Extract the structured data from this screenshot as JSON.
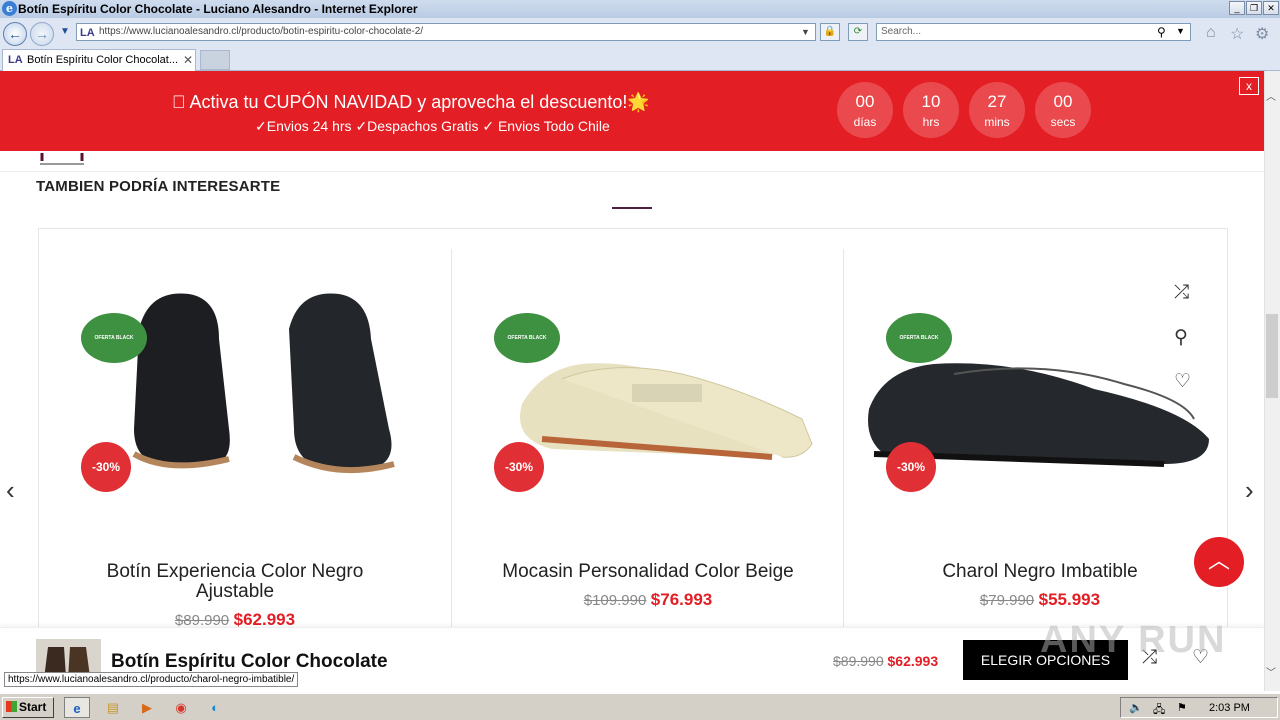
{
  "window": {
    "title": "Botín Espíritu Color Chocolate - Luciano Alesandro - Internet Explorer"
  },
  "address": {
    "favicon": "LA",
    "url": "https://www.lucianoalesandro.cl/producto/botin-espiritu-color-chocolate-2/"
  },
  "search": {
    "placeholder": "Search..."
  },
  "tab": {
    "label": "Botín Espíritu Color Chocolat..."
  },
  "promo": {
    "line1": "\u0000 Activa tu CUPÓN NAVIDAD y aprovecha el descuento!🌟",
    "line2": "✓Envios 24 hrs ✓Despachos Gratis ✓ Envios Todo Chile",
    "countdown": [
      {
        "value": "00",
        "unit": "días"
      },
      {
        "value": "10",
        "unit": "hrs"
      },
      {
        "value": "27",
        "unit": "mins"
      },
      {
        "value": "00",
        "unit": "secs"
      }
    ],
    "close": "x"
  },
  "section": {
    "title": "TAMBIEN PODRÍA INTERESARTE"
  },
  "products": [
    {
      "badge": "OFERTA BLACK",
      "discount": "-30%",
      "name": "Botín Experiencia Color Negro Ajustable",
      "old_price": "$89.990",
      "price": "$62.993"
    },
    {
      "badge": "OFERTA BLACK",
      "discount": "-30%",
      "name": "Mocasin Personalidad Color Beige",
      "old_price": "$109.990",
      "price": "$76.993"
    },
    {
      "badge": "OFERTA BLACK",
      "discount": "-30%",
      "name": "Charol Negro Imbatible",
      "old_price": "$79.990",
      "price": "$55.993"
    }
  ],
  "sticky": {
    "name": "Botín Espíritu Color Chocolate",
    "old_price": "$89.990",
    "price": "$62.993",
    "button": "ELEGIR OPCIONES"
  },
  "status": {
    "url": "https://www.lucianoalesandro.cl/producto/charol-negro-imbatible/"
  },
  "taskbar": {
    "start": "Start",
    "clock": "2:03 PM"
  },
  "watermark": "ANY RUN"
}
